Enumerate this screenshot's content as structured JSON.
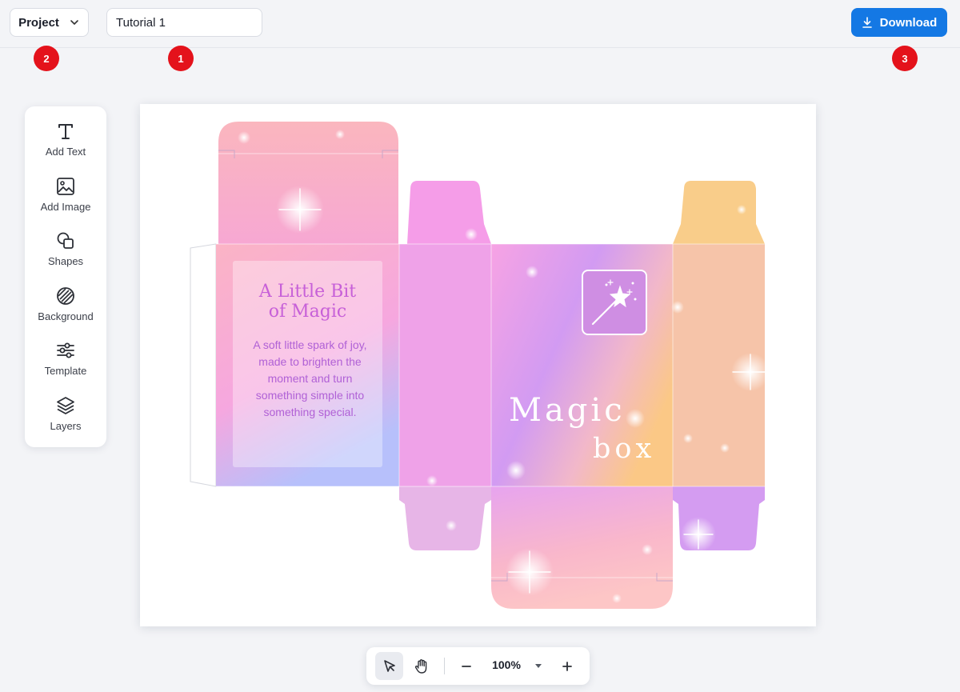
{
  "topbar": {
    "project_label": "Project",
    "title_value": "Tutorial 1",
    "download_label": "Download"
  },
  "annotations": [
    "1",
    "2",
    "3"
  ],
  "toolbar": {
    "items": [
      {
        "label": "Add Text",
        "icon": "text-icon"
      },
      {
        "label": "Add Image",
        "icon": "image-icon"
      },
      {
        "label": "Shapes",
        "icon": "shapes-icon"
      },
      {
        "label": "Background",
        "icon": "background-icon"
      },
      {
        "label": "Template",
        "icon": "sliders-icon"
      },
      {
        "label": "Layers",
        "icon": "layers-icon"
      }
    ]
  },
  "design": {
    "side_title_line1": "A Little Bit",
    "side_title_line2": "of Magic",
    "side_body": "A soft little spark of joy, made to brighten the moment and turn something simple into something special.",
    "front_word1": "Magic",
    "front_word2": "box",
    "logo_icon": "magic-wand-icon"
  },
  "zoom": {
    "value": "100%"
  },
  "colors": {
    "accent": "#1478e4",
    "badge": "#e4121b",
    "canvas_background": "#ffffff"
  }
}
